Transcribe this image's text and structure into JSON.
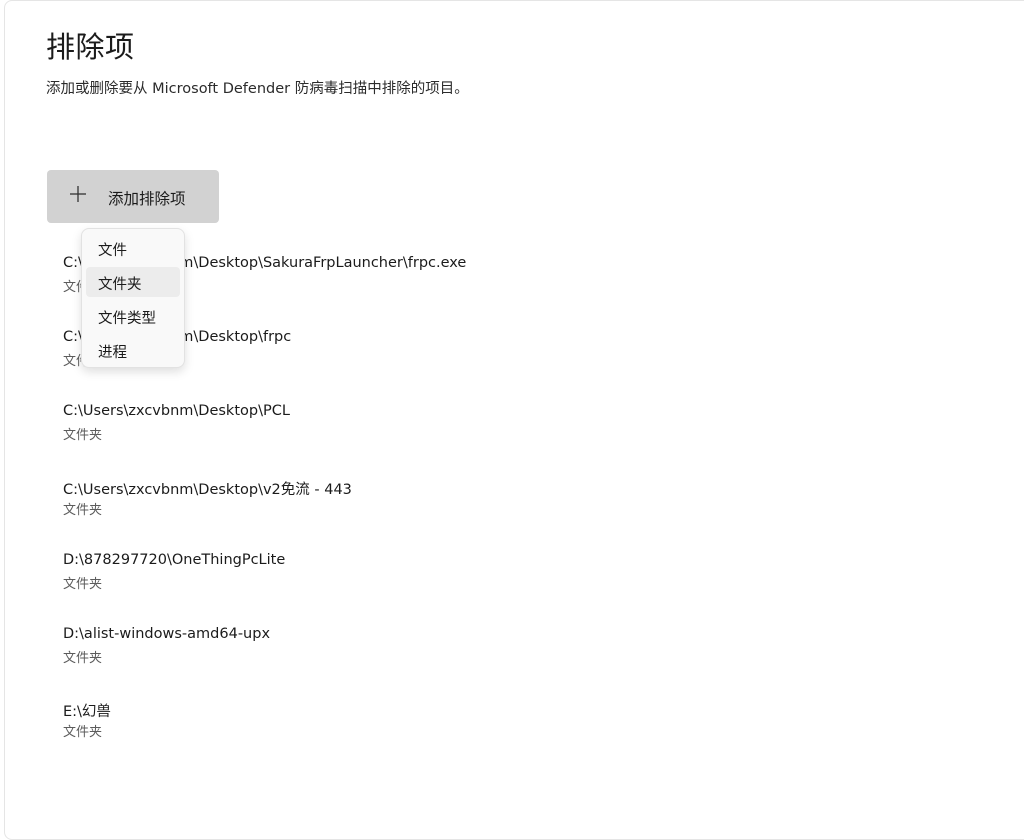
{
  "header": {
    "title": "排除项",
    "description": "添加或删除要从 Microsoft Defender 防病毒扫描中排除的项目。"
  },
  "add_button": {
    "icon": "plus-icon",
    "label": "添加排除项"
  },
  "exclusions": [
    {
      "path": "C:\\Users\\zxcvbnm\\Desktop\\SakuraFrpLauncher\\frpc.exe",
      "type": "文件"
    },
    {
      "path": "C:\\Users\\zxcvbnm\\Desktop\\frpc",
      "type": "文件夹"
    },
    {
      "path": "C:\\Users\\zxcvbnm\\Desktop\\PCL",
      "type": "文件夹"
    },
    {
      "path": "C:\\Users\\zxcvbnm\\Desktop\\v2免流 - 443",
      "type": "文件夹"
    },
    {
      "path": "D:\\878297720\\OneThingPcLite",
      "type": "文件夹"
    },
    {
      "path": "D:\\alist-windows-amd64-upx",
      "type": "文件夹"
    },
    {
      "path": "E:\\幻兽",
      "type": "文件夹"
    }
  ],
  "dropdown_menu": {
    "items": [
      {
        "label": "文件"
      },
      {
        "label": "文件夹"
      },
      {
        "label": "文件类型"
      },
      {
        "label": "进程"
      }
    ],
    "hovered_item": "文件夹"
  },
  "colors": {
    "button_bg": "#d2d2d2",
    "menu_bg": "#f9f9f9",
    "menu_hover": "#ececec",
    "secondary_text": "#5c5c5c"
  }
}
